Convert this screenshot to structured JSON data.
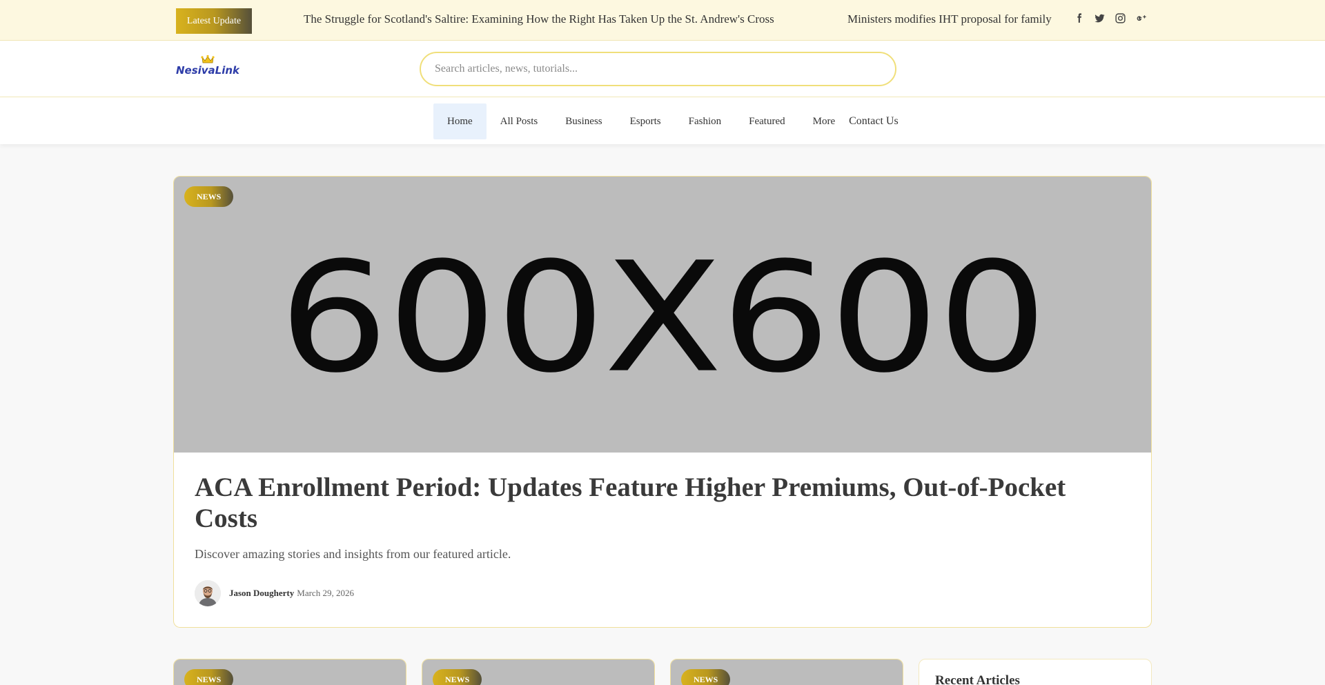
{
  "topbar": {
    "badge": "Latest Update",
    "ticker": [
      "The Struggle for Scotland's Saltire: Examining How the Right Has Taken Up the St. Andrew's Cross",
      "Ministers modifies IHT proposal for family"
    ],
    "socials": [
      "facebook-icon",
      "twitter-icon",
      "instagram-icon",
      "google-plus-icon"
    ]
  },
  "header": {
    "logo_text": "NesivaLink",
    "search_placeholder": "Search articles, news, tutorials..."
  },
  "nav": {
    "items": [
      "Home",
      "All Posts",
      "Business",
      "Esports",
      "Fashion",
      "Featured",
      "More"
    ],
    "active": "Home",
    "contact": "Contact Us"
  },
  "featured": {
    "tag": "NEWS",
    "image_text": "600X600",
    "title": "ACA Enrollment Period: Updates Feature Higher Premiums, Out-of-Pocket Costs",
    "description": "Discover amazing stories and insights from our featured article.",
    "author": "Jason Dougherty",
    "date": "March 29, 2026"
  },
  "cards": [
    {
      "tag": "NEWS"
    },
    {
      "tag": "NEWS"
    },
    {
      "tag": "NEWS"
    }
  ],
  "sidebar": {
    "recent_title": "Recent Articles"
  },
  "colors": {
    "topbar_bg": "#fdf8e0",
    "accent_gold": "#d8b21e",
    "border_gold": "#f0df9a",
    "active_nav_bg": "#e8f1fc"
  }
}
